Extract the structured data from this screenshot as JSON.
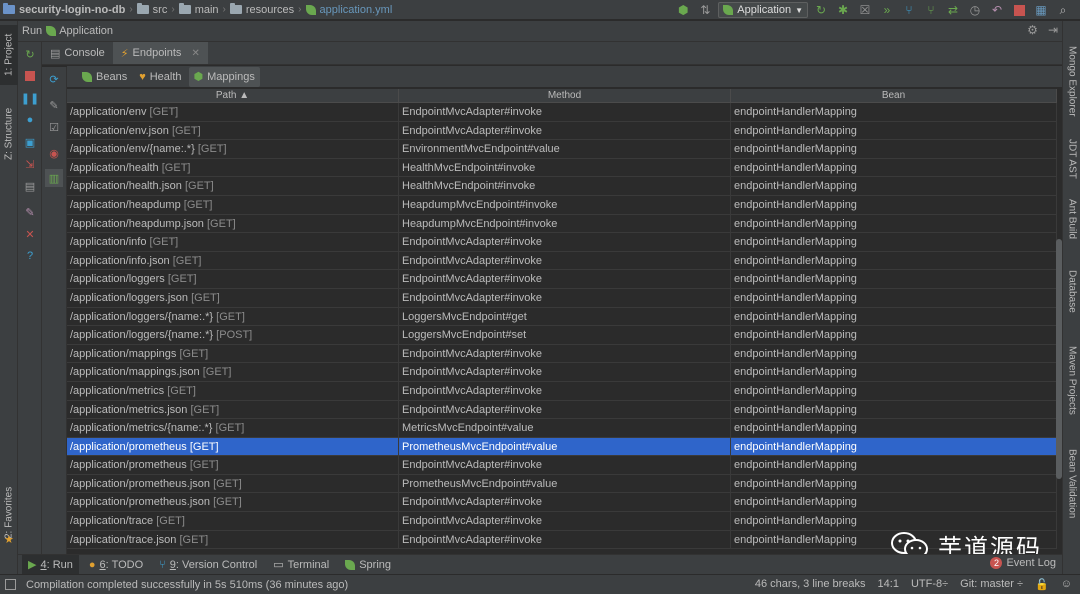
{
  "navbar": {
    "breadcrumbs": [
      {
        "label": "security-login-no-db",
        "icon": "folder-icon"
      },
      {
        "label": "src",
        "icon": "folder-icon"
      },
      {
        "label": "main",
        "icon": "folder-icon"
      },
      {
        "label": "resources",
        "icon": "folder-icon"
      },
      {
        "label": "application.yml",
        "icon": "yml-file-icon"
      }
    ],
    "run_config": "Application"
  },
  "left_strip": {
    "project": "1: Project",
    "structure": "Z: Structure",
    "favorites": "2: Favorites"
  },
  "right_strip": {
    "mongo": "Mongo Explorer",
    "jdt": "JDT AST",
    "ant": "Ant Build",
    "database": "Database",
    "maven": "Maven Projects",
    "bean_validation": "Bean Validation"
  },
  "run_window": {
    "title": "Run",
    "app_name": "Application",
    "tabs": {
      "console": "Console",
      "endpoints": "Endpoints"
    },
    "endpoint_tabs": {
      "beans": "Beans",
      "health": "Health",
      "mappings": "Mappings"
    }
  },
  "table": {
    "columns": {
      "path": "Path ▲",
      "method": "Method",
      "bean": "Bean"
    },
    "rows": [
      {
        "path": "/application/env",
        "verb": "[GET]",
        "method": "EndpointMvcAdapter#invoke",
        "bean": "endpointHandlerMapping"
      },
      {
        "path": "/application/env.json",
        "verb": "[GET]",
        "method": "EndpointMvcAdapter#invoke",
        "bean": "endpointHandlerMapping"
      },
      {
        "path": "/application/env/{name:.*}",
        "verb": "[GET]",
        "method": "EnvironmentMvcEndpoint#value",
        "bean": "endpointHandlerMapping"
      },
      {
        "path": "/application/health",
        "verb": "[GET]",
        "method": "HealthMvcEndpoint#invoke",
        "bean": "endpointHandlerMapping"
      },
      {
        "path": "/application/health.json",
        "verb": "[GET]",
        "method": "HealthMvcEndpoint#invoke",
        "bean": "endpointHandlerMapping"
      },
      {
        "path": "/application/heapdump",
        "verb": "[GET]",
        "method": "HeapdumpMvcEndpoint#invoke",
        "bean": "endpointHandlerMapping"
      },
      {
        "path": "/application/heapdump.json",
        "verb": "[GET]",
        "method": "HeapdumpMvcEndpoint#invoke",
        "bean": "endpointHandlerMapping"
      },
      {
        "path": "/application/info",
        "verb": "[GET]",
        "method": "EndpointMvcAdapter#invoke",
        "bean": "endpointHandlerMapping"
      },
      {
        "path": "/application/info.json",
        "verb": "[GET]",
        "method": "EndpointMvcAdapter#invoke",
        "bean": "endpointHandlerMapping"
      },
      {
        "path": "/application/loggers",
        "verb": "[GET]",
        "method": "EndpointMvcAdapter#invoke",
        "bean": "endpointHandlerMapping"
      },
      {
        "path": "/application/loggers.json",
        "verb": "[GET]",
        "method": "EndpointMvcAdapter#invoke",
        "bean": "endpointHandlerMapping"
      },
      {
        "path": "/application/loggers/{name:.*}",
        "verb": "[GET]",
        "method": "LoggersMvcEndpoint#get",
        "bean": "endpointHandlerMapping"
      },
      {
        "path": "/application/loggers/{name:.*}",
        "verb": "[POST]",
        "method": "LoggersMvcEndpoint#set",
        "bean": "endpointHandlerMapping"
      },
      {
        "path": "/application/mappings",
        "verb": "[GET]",
        "method": "EndpointMvcAdapter#invoke",
        "bean": "endpointHandlerMapping"
      },
      {
        "path": "/application/mappings.json",
        "verb": "[GET]",
        "method": "EndpointMvcAdapter#invoke",
        "bean": "endpointHandlerMapping"
      },
      {
        "path": "/application/metrics",
        "verb": "[GET]",
        "method": "EndpointMvcAdapter#invoke",
        "bean": "endpointHandlerMapping"
      },
      {
        "path": "/application/metrics.json",
        "verb": "[GET]",
        "method": "EndpointMvcAdapter#invoke",
        "bean": "endpointHandlerMapping"
      },
      {
        "path": "/application/metrics/{name:.*}",
        "verb": "[GET]",
        "method": "MetricsMvcEndpoint#value",
        "bean": "endpointHandlerMapping"
      },
      {
        "path": "/application/prometheus",
        "verb": "[GET]",
        "method": "PrometheusMvcEndpoint#value",
        "bean": "endpointHandlerMapping",
        "selected": true
      },
      {
        "path": "/application/prometheus",
        "verb": "[GET]",
        "method": "EndpointMvcAdapter#invoke",
        "bean": "endpointHandlerMapping"
      },
      {
        "path": "/application/prometheus.json",
        "verb": "[GET]",
        "method": "PrometheusMvcEndpoint#value",
        "bean": "endpointHandlerMapping"
      },
      {
        "path": "/application/prometheus.json",
        "verb": "[GET]",
        "method": "EndpointMvcAdapter#invoke",
        "bean": "endpointHandlerMapping"
      },
      {
        "path": "/application/trace",
        "verb": "[GET]",
        "method": "EndpointMvcAdapter#invoke",
        "bean": "endpointHandlerMapping"
      },
      {
        "path": "/application/trace.json",
        "verb": "[GET]",
        "method": "EndpointMvcAdapter#invoke",
        "bean": "endpointHandlerMapping"
      }
    ]
  },
  "bottom_tabs": {
    "run": {
      "num": "4",
      "label": ": Run"
    },
    "todo": {
      "num": "6",
      "label": ": TODO"
    },
    "vcs": {
      "num": "9",
      "label": ": Version Control"
    },
    "terminal": "Terminal",
    "spring": "Spring",
    "event_log": "Event Log",
    "event_count": "2"
  },
  "status": {
    "message": "Compilation completed successfully in 5s 510ms (36 minutes ago)",
    "chars": "46 chars, 3 line breaks",
    "position": "14:1",
    "encoding": "UTF-8÷",
    "git": "Git: master ÷"
  },
  "watermark": "芋道源码",
  "colors": {
    "selection": "#2f65ca",
    "background": "#2b2b2b",
    "panel": "#3c3f41",
    "spring_green": "#6aa84f"
  }
}
